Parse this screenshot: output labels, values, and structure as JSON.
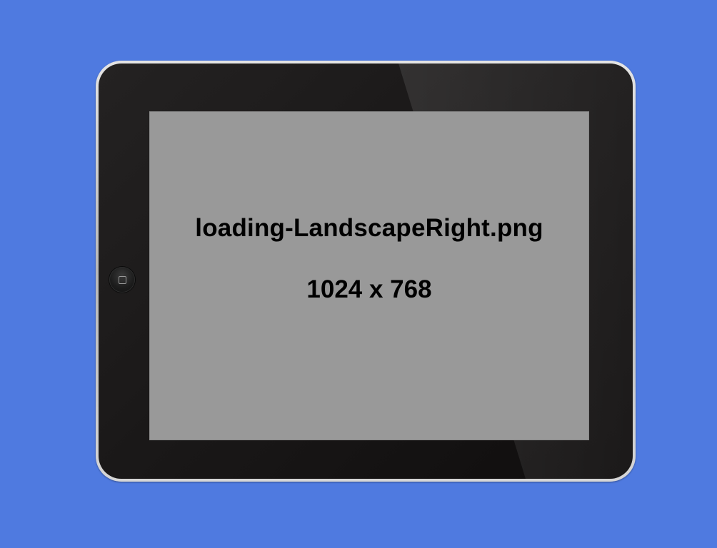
{
  "background_color": "#4f7ae0",
  "device": {
    "bezel_color": "#1a1818",
    "frame_color": "#c8c8c8",
    "home_button_icon": "home-button-square-icon"
  },
  "screen": {
    "background_color": "#999999",
    "file_name": "loading-LandscapeRight.png",
    "dimensions": "1024 x 768"
  }
}
